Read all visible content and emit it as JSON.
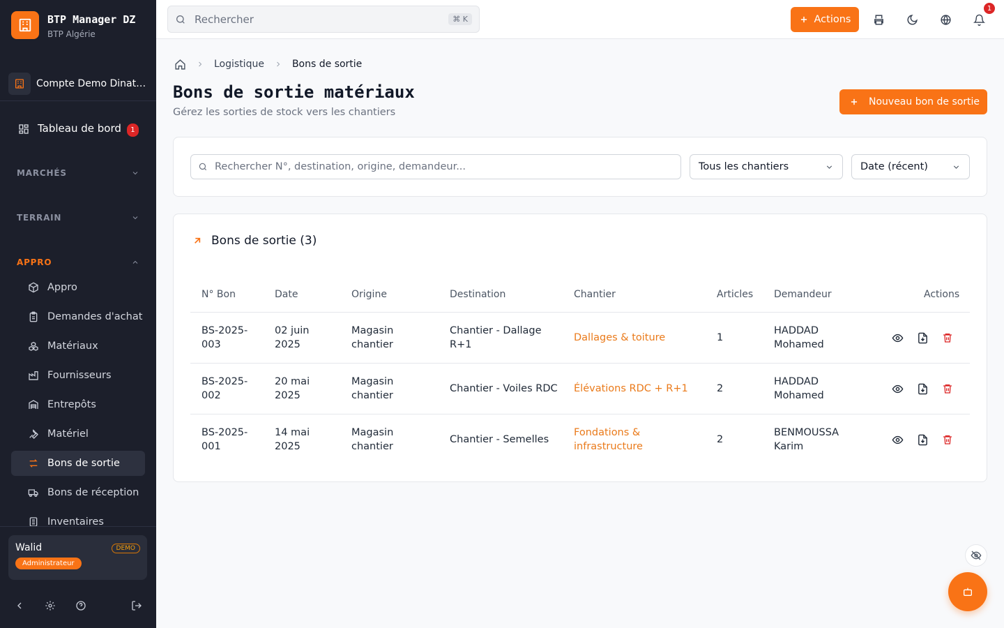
{
  "brand": {
    "name": "BTP Manager DZ",
    "subtitle": "BTP Algérie"
  },
  "account": {
    "name": "Compte Demo Dinatech"
  },
  "sidebar": {
    "dashboard": {
      "label": "Tableau de bord",
      "badge": "1"
    },
    "sections": [
      {
        "label": "MARCHÉS",
        "expanded": false
      },
      {
        "label": "TERRAIN",
        "expanded": false
      },
      {
        "label": "APPRO",
        "expanded": true
      }
    ],
    "items": [
      {
        "label": "Appro",
        "icon": "box-icon"
      },
      {
        "label": "Demandes d'achat",
        "icon": "clipboard-icon"
      },
      {
        "label": "Matériaux",
        "icon": "boxes-icon"
      },
      {
        "label": "Fournisseurs",
        "icon": "factory-icon"
      },
      {
        "label": "Entrepôts",
        "icon": "warehouse-icon"
      },
      {
        "label": "Matériel",
        "icon": "wrench-icon"
      },
      {
        "label": "Bons de sortie",
        "icon": "transfer-icon",
        "active": true
      },
      {
        "label": "Bons de réception",
        "icon": "truck-icon"
      },
      {
        "label": "Inventaires",
        "icon": "sheet-icon"
      }
    ]
  },
  "user": {
    "name": "Walid",
    "demo_label": "DEMO",
    "role": "Administrateur"
  },
  "topbar": {
    "search_placeholder": "Rechercher",
    "shortcut": "⌘ K",
    "actions_label": "Actions",
    "notification_count": "1"
  },
  "breadcrumb": {
    "parent": "Logistique",
    "current": "Bons de sortie"
  },
  "page": {
    "title": "Bons de sortie matériaux",
    "subtitle": "Gérez les sorties de stock vers les chantiers",
    "new_button": "Nouveau bon de sortie"
  },
  "filters": {
    "search_placeholder": "Rechercher N°, destination, origine, demandeur...",
    "chantier_select": "Tous les chantiers",
    "sort_select": "Date (récent)"
  },
  "table": {
    "title": "Bons de sortie (3)",
    "columns": [
      "N° Bon",
      "Date",
      "Origine",
      "Destination",
      "Chantier",
      "Articles",
      "Demandeur",
      "Actions"
    ],
    "rows": [
      {
        "num": "BS-2025-003",
        "date": "02 juin 2025",
        "origine": "Magasin chantier",
        "destination": "Chantier - Dallage R+1",
        "chantier": "Dallages & toiture",
        "articles": "1",
        "demandeur": "HADDAD Mohamed"
      },
      {
        "num": "BS-2025-002",
        "date": "20 mai 2025",
        "origine": "Magasin chantier",
        "destination": "Chantier - Voiles RDC",
        "chantier": "Élévations RDC + R+1",
        "articles": "2",
        "demandeur": "HADDAD Mohamed"
      },
      {
        "num": "BS-2025-001",
        "date": "14 mai 2025",
        "origine": "Magasin chantier",
        "destination": "Chantier - Semelles",
        "chantier": "Fondations & infrastructure",
        "articles": "2",
        "demandeur": "BENMOUSSA Karim"
      }
    ]
  },
  "colors": {
    "accent": "#f97316",
    "sidebar_bg": "#1c1f2b",
    "danger": "#dc2626"
  }
}
